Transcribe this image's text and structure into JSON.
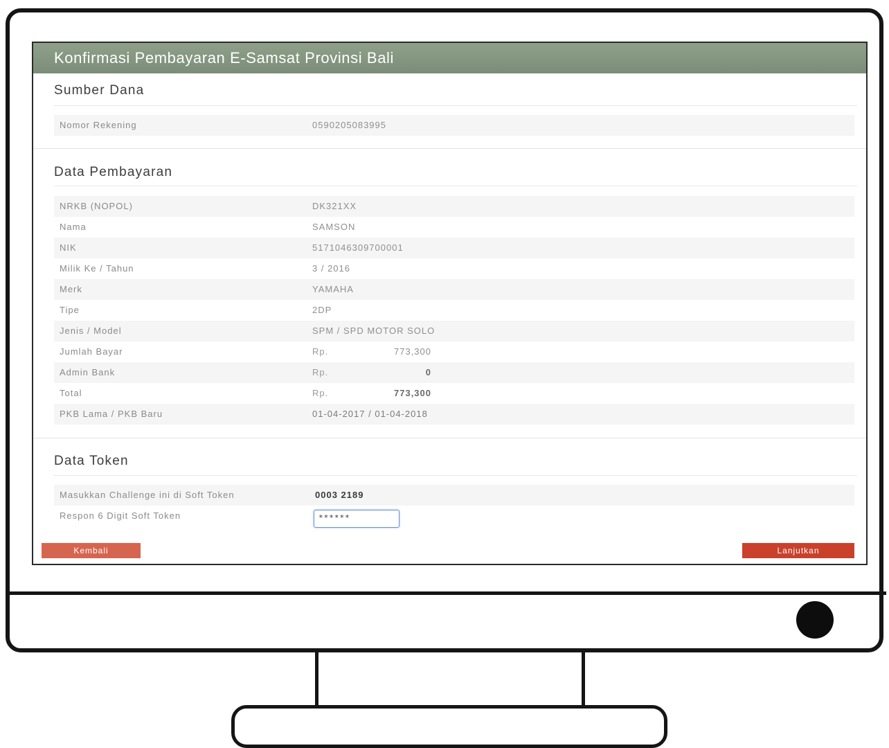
{
  "window": {
    "title": "Konfirmasi Pembayaran E-Samsat Provinsi Bali"
  },
  "sumber_dana": {
    "heading": "Sumber Dana",
    "rows": [
      {
        "label": "Nomor Rekening",
        "value": "0590205083995"
      }
    ]
  },
  "data_pembayaran": {
    "heading": "Data Pembayaran",
    "rows": [
      {
        "label": "NRKB (NOPOL)",
        "value": "DK321XX"
      },
      {
        "label": "Nama",
        "value": "SAMSON"
      },
      {
        "label": "NIK",
        "value": "5171046309700001"
      },
      {
        "label": "Milik Ke / Tahun",
        "value": "3 / 2016"
      },
      {
        "label": "Merk",
        "value": "YAMAHA"
      },
      {
        "label": "Tipe",
        "value": "2DP"
      },
      {
        "label": "Jenis / Model",
        "value": "SPM / SPD MOTOR SOLO"
      },
      {
        "label": "Jumlah Bayar",
        "currency": "Rp.",
        "amount": "773,300"
      },
      {
        "label": "Admin Bank",
        "currency": "Rp.",
        "amount": "0"
      },
      {
        "label": "Total",
        "currency": "Rp.",
        "amount": "773,300"
      },
      {
        "label": "PKB Lama / PKB Baru",
        "value": "01-04-2017 / 01-04-2018"
      }
    ]
  },
  "data_token": {
    "heading": "Data Token",
    "challenge_label": "Masukkan Challenge ini di Soft Token",
    "challenge_value": "0003 2189",
    "response_label": "Respon 6 Digit Soft Token",
    "response_value": "******"
  },
  "buttons": {
    "back": "Kembali",
    "next": "Lanjutkan"
  }
}
